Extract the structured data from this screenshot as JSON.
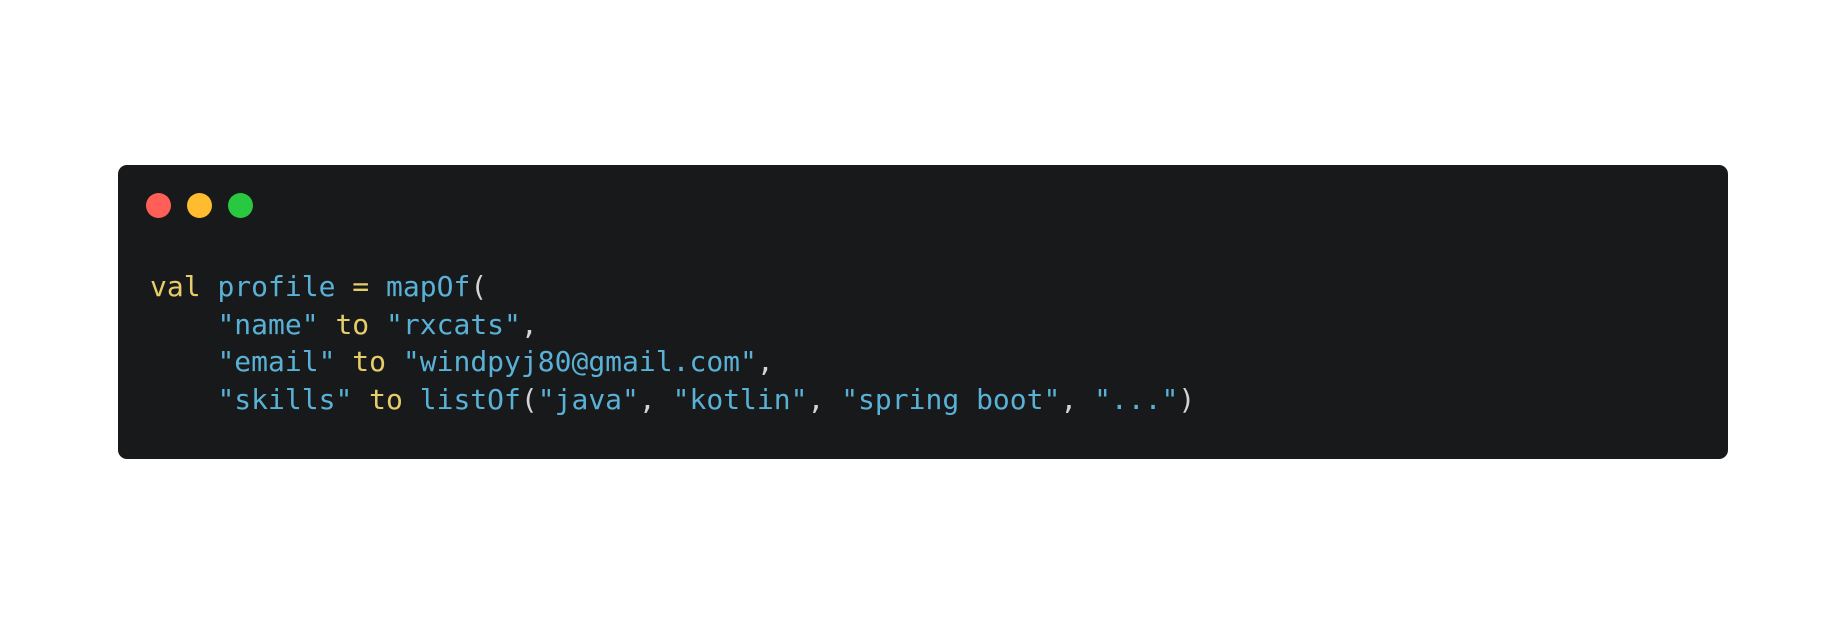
{
  "window": {
    "controls": [
      {
        "name": "close",
        "color": "#ff5f57"
      },
      {
        "name": "minimize",
        "color": "#febc2e"
      },
      {
        "name": "maximize",
        "color": "#28c840"
      }
    ]
  },
  "code": {
    "lines": [
      [
        {
          "text": "val",
          "kind": "keyword"
        },
        {
          "text": " ",
          "kind": "punct"
        },
        {
          "text": "profile",
          "kind": "identifier"
        },
        {
          "text": " = ",
          "kind": "keyword"
        },
        {
          "text": "mapOf",
          "kind": "identifier"
        },
        {
          "text": "(",
          "kind": "punct"
        }
      ],
      [
        {
          "text": "    ",
          "kind": "punct"
        },
        {
          "text": "\"name\"",
          "kind": "string"
        },
        {
          "text": " to ",
          "kind": "keyword"
        },
        {
          "text": "\"rxcats\"",
          "kind": "string"
        },
        {
          "text": ",",
          "kind": "punct"
        }
      ],
      [
        {
          "text": "    ",
          "kind": "punct"
        },
        {
          "text": "\"email\"",
          "kind": "string"
        },
        {
          "text": " to ",
          "kind": "keyword"
        },
        {
          "text": "\"windpyj80@gmail.com\"",
          "kind": "string"
        },
        {
          "text": ",",
          "kind": "punct"
        }
      ],
      [
        {
          "text": "    ",
          "kind": "punct"
        },
        {
          "text": "\"skills\"",
          "kind": "string"
        },
        {
          "text": " to ",
          "kind": "keyword"
        },
        {
          "text": "listOf",
          "kind": "identifier"
        },
        {
          "text": "(",
          "kind": "punct"
        },
        {
          "text": "\"java\"",
          "kind": "string"
        },
        {
          "text": ", ",
          "kind": "punct"
        },
        {
          "text": "\"kotlin\"",
          "kind": "string"
        },
        {
          "text": ", ",
          "kind": "punct"
        },
        {
          "text": "\"spring boot\"",
          "kind": "string"
        },
        {
          "text": ", ",
          "kind": "punct"
        },
        {
          "text": "\"...\"",
          "kind": "string"
        },
        {
          "text": ")",
          "kind": "punct"
        }
      ]
    ]
  },
  "colors": {
    "background": "#ffffff",
    "window": "#18191b",
    "keyword": "#e6cd69",
    "identifier": "#5ab1d6",
    "string": "#5ab1d6",
    "punct": "#d4d4d4"
  }
}
